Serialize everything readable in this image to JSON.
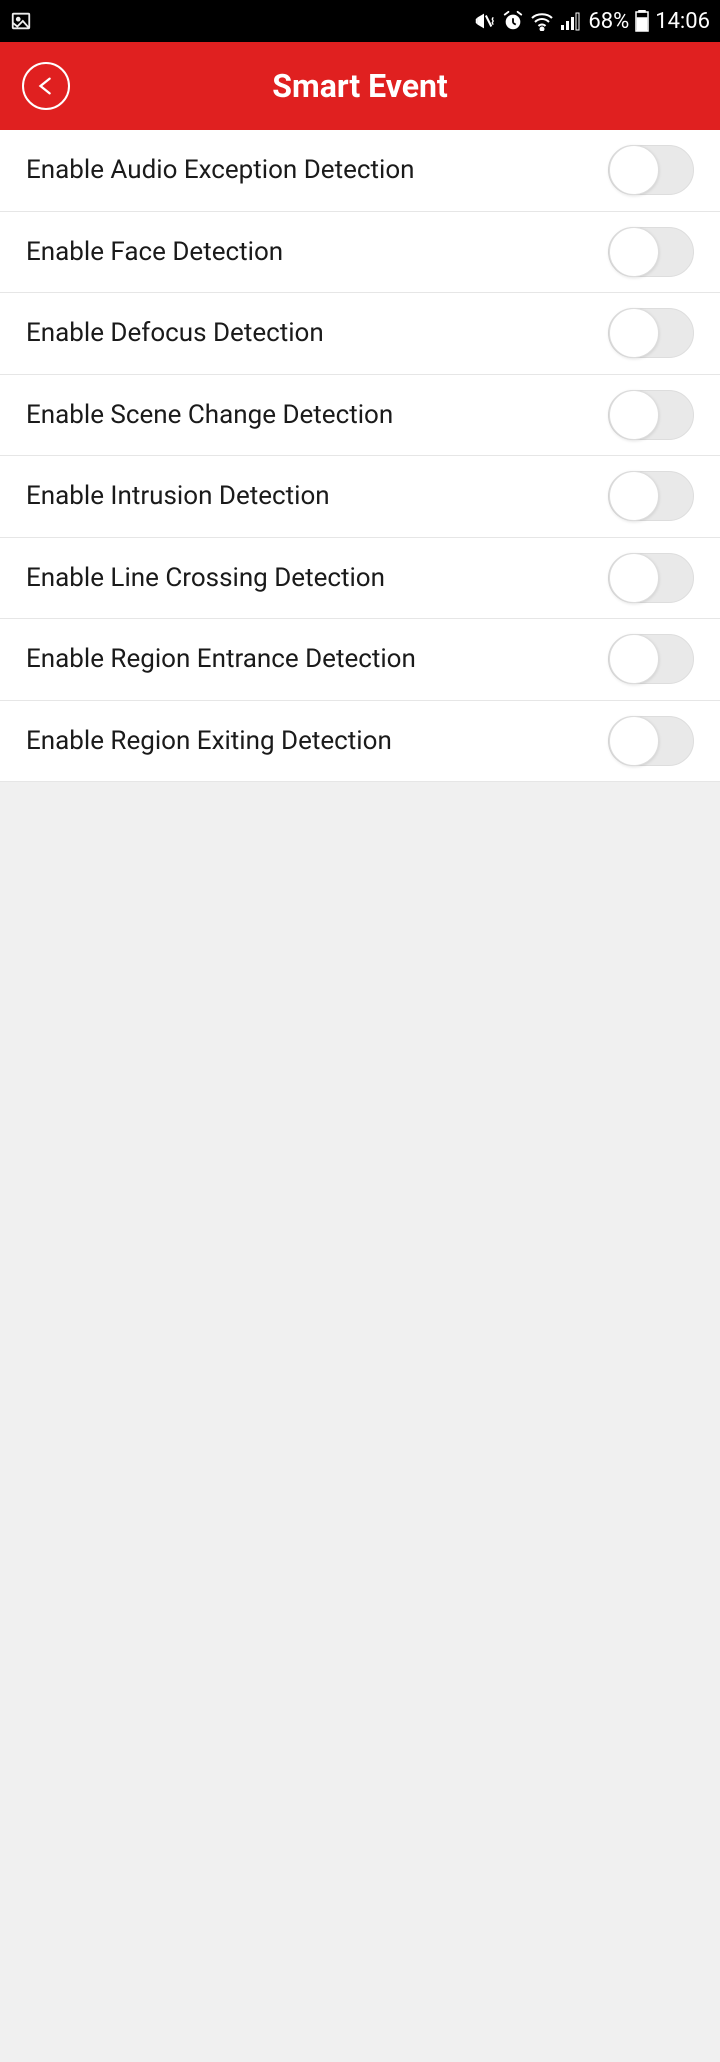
{
  "statusBar": {
    "battery": "68%",
    "time": "14:06"
  },
  "header": {
    "title": "Smart Event"
  },
  "settings": [
    {
      "label": "Enable Audio Exception Detection",
      "enabled": false
    },
    {
      "label": "Enable Face Detection",
      "enabled": false
    },
    {
      "label": "Enable Defocus Detection",
      "enabled": false
    },
    {
      "label": "Enable Scene Change Detection",
      "enabled": false
    },
    {
      "label": "Enable Intrusion Detection",
      "enabled": false
    },
    {
      "label": "Enable Line Crossing Detection",
      "enabled": false
    },
    {
      "label": "Enable Region Entrance Detection",
      "enabled": false
    },
    {
      "label": "Enable Region Exiting Detection",
      "enabled": false
    }
  ]
}
